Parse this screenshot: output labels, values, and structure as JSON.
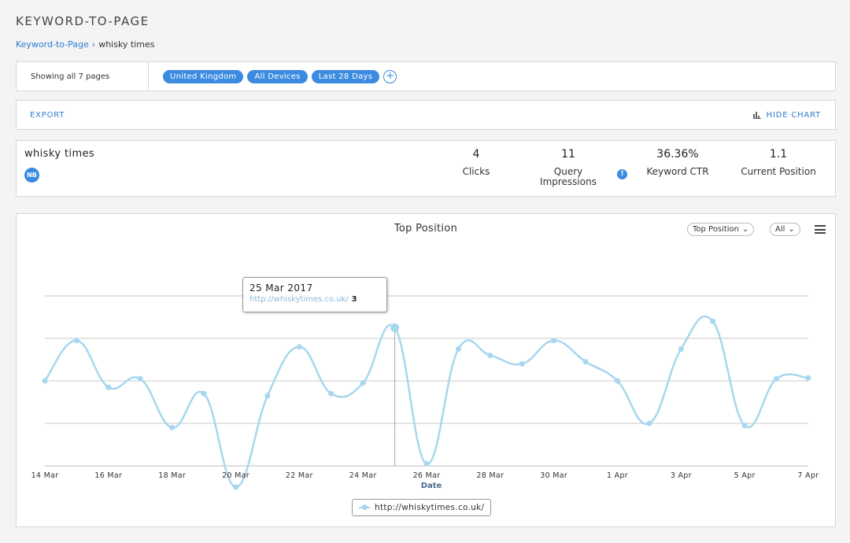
{
  "page": {
    "title": "KEYWORD-TO-PAGE"
  },
  "breadcrumb": {
    "root": "Keyword-to-Page",
    "current": "whisky times"
  },
  "filters": {
    "summary": "Showing all 7 pages",
    "chips": [
      "United Kingdom",
      "All Devices",
      "Last 28 Days"
    ],
    "add_label": "+"
  },
  "actions": {
    "export_label": "EXPORT",
    "hide_chart_label": "HIDE CHART"
  },
  "stats": {
    "keyword": "whisky times",
    "badge": "NB",
    "clicks": {
      "value": "4",
      "label": "Clicks"
    },
    "impressions": {
      "value": "11",
      "label_line1": "Query",
      "label_line2": "Impressions"
    },
    "info_icon": "!",
    "ctr": {
      "value": "36.36%",
      "label": "Keyword CTR"
    },
    "position": {
      "value": "1.1",
      "label": "Current Position"
    }
  },
  "chart_controls": {
    "metric_select": "Top Position",
    "filter_select": "All"
  },
  "tooltip": {
    "date": "25 Mar 2017",
    "url": "http://whiskytimes.co.uk/",
    "value": "3"
  },
  "colors": {
    "accent": "#3b8be0",
    "series": "#a6d7ef",
    "link": "#2b7bd2"
  },
  "chart_data": {
    "type": "line",
    "title": "Top Position",
    "xlabel": "Date",
    "ylabel": "",
    "x_tick_labels": [
      "14 Mar",
      "16 Mar",
      "18 Mar",
      "20 Mar",
      "22 Mar",
      "24 Mar",
      "26 Mar",
      "28 Mar",
      "30 Mar",
      "1 Apr",
      "3 Apr",
      "5 Apr",
      "7 Apr"
    ],
    "x": [
      "14 Mar",
      "15 Mar",
      "16 Mar",
      "17 Mar",
      "18 Mar",
      "19 Mar",
      "20 Mar",
      "21 Mar",
      "22 Mar",
      "23 Mar",
      "24 Mar",
      "25 Mar",
      "26 Mar",
      "27 Mar",
      "28 Mar",
      "29 Mar",
      "30 Mar",
      "31 Mar",
      "1 Apr",
      "2 Apr",
      "3 Apr",
      "4 Apr",
      "5 Apr",
      "6 Apr",
      "7 Apr"
    ],
    "y_reversed": true,
    "ylim": [
      1,
      6
    ],
    "grid": true,
    "legend_position": "bottom-center",
    "series": [
      {
        "name": "http://whiskytimes.co.uk/",
        "values": [
          4.0,
          3.05,
          4.15,
          3.95,
          5.1,
          4.3,
          6.5,
          4.35,
          3.2,
          4.3,
          4.05,
          2.75,
          5.95,
          3.25,
          3.4,
          3.6,
          3.05,
          3.55,
          4.0,
          5.0,
          3.25,
          2.6,
          5.05,
          3.95,
          3.93
        ],
        "color": "#a6d7ef"
      }
    ],
    "highlighted_index": 11
  }
}
